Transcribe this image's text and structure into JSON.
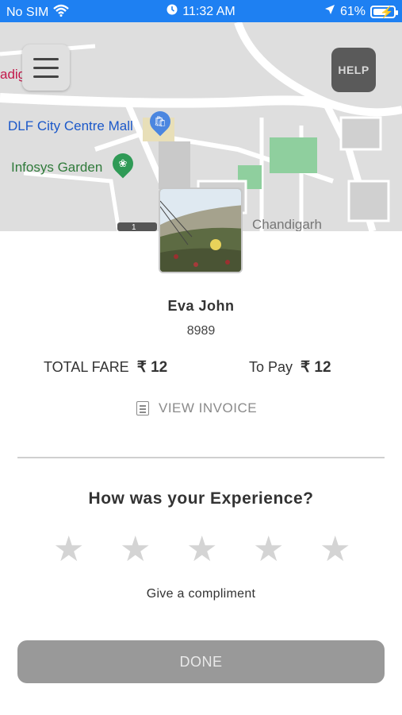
{
  "status_bar": {
    "carrier": "No SIM",
    "time": "11:32 AM",
    "battery_percent": "61%",
    "icons": [
      "wifi-icon",
      "alarm-icon",
      "location-arrow-icon",
      "battery-charging-icon"
    ]
  },
  "map": {
    "labels": {
      "partial_left": "adig",
      "mall": "DLF City Centre Mall",
      "garden": "Infosys Garden",
      "city_partial": "Chandigarh",
      "scale_num": "1"
    },
    "colors": {
      "road": "#ffffff",
      "land": "#dedede",
      "park": "#8fcf9e"
    }
  },
  "header": {
    "menu_icon": "hamburger-menu-icon",
    "help_label": "HELP"
  },
  "driver": {
    "name": "Eva John",
    "code": "8989"
  },
  "fare": {
    "total_label": "TOTAL FARE",
    "total_value": "₹ 12",
    "pay_label": "To Pay",
    "pay_value": "₹ 12"
  },
  "invoice": {
    "label": "VIEW INVOICE",
    "icon": "document-icon"
  },
  "rating": {
    "question": "How was your Experience?",
    "max_stars": 5,
    "selected_stars": 0,
    "compliment_label": "Give a compliment"
  },
  "done_label": "DONE",
  "colors": {
    "status_bar": "#1e80f2",
    "done_button": "#999999",
    "star_empty": "#d4d4d4"
  }
}
